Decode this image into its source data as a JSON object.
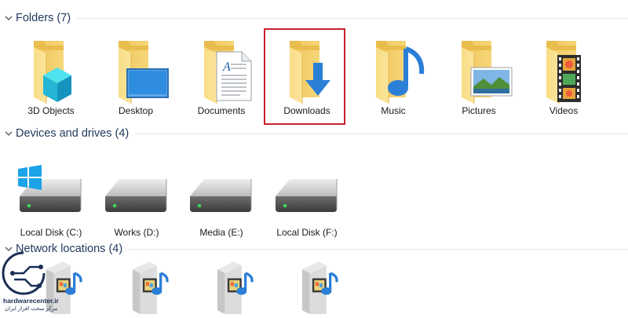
{
  "sections": {
    "folders": {
      "title": "Folders (7)"
    },
    "devices": {
      "title": "Devices and drives (4)"
    },
    "network": {
      "title": "Network locations (4)"
    }
  },
  "folders": [
    {
      "label": "3D Objects",
      "icon": "3d-objects-folder-icon"
    },
    {
      "label": "Desktop",
      "icon": "desktop-folder-icon"
    },
    {
      "label": "Documents",
      "icon": "documents-folder-icon"
    },
    {
      "label": "Downloads",
      "icon": "downloads-folder-icon",
      "highlighted": true
    },
    {
      "label": "Music",
      "icon": "music-folder-icon"
    },
    {
      "label": "Pictures",
      "icon": "pictures-folder-icon"
    },
    {
      "label": "Videos",
      "icon": "videos-folder-icon"
    }
  ],
  "drives": [
    {
      "label": "Local Disk (C:)",
      "icon": "system-drive-icon"
    },
    {
      "label": "Works (D:)",
      "icon": "hard-drive-icon"
    },
    {
      "label": "Media (E:)",
      "icon": "hard-drive-icon"
    },
    {
      "label": "Local Disk (F:)",
      "icon": "hard-drive-icon"
    }
  ],
  "network_locations": [
    {
      "icon": "media-server-icon"
    },
    {
      "icon": "media-server-icon"
    },
    {
      "icon": "media-server-icon"
    },
    {
      "icon": "media-server-icon"
    }
  ],
  "watermark": {
    "brand": "hardwarecenter.ir",
    "tagline": "مرکز سخت افزار ایران"
  },
  "colors": {
    "folder_yellow": "#f8d775",
    "folder_dark": "#e7b94a",
    "section_title": "#1e395b",
    "highlight_border": "#c8202f",
    "download_arrow": "#2b7fd6"
  }
}
